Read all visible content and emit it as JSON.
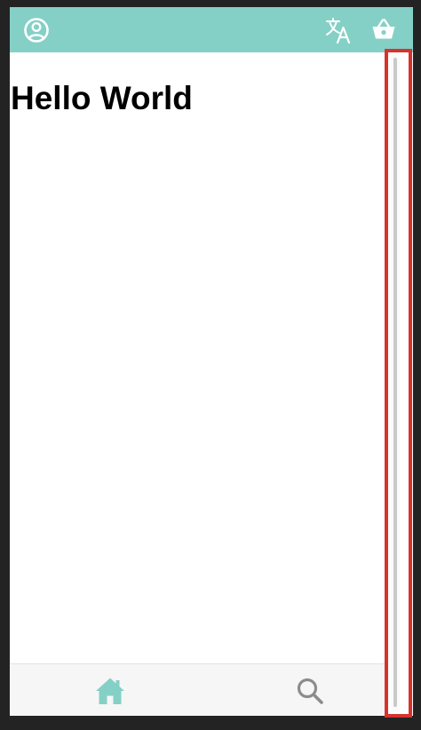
{
  "header": {
    "icons": {
      "account": "account-circle-icon",
      "translate": "translate-icon",
      "basket": "basket-icon"
    },
    "colors": {
      "background": "#84d0c6",
      "icon": "#ffffff"
    }
  },
  "main": {
    "heading": "Hello World"
  },
  "bottom_nav": {
    "items": [
      {
        "icon": "home-icon",
        "active": true,
        "color": "#84d0c6"
      },
      {
        "icon": "search-icon",
        "active": false,
        "color": "#8c8c8c"
      }
    ]
  },
  "colors": {
    "frame": "#232323",
    "highlight": "#d8322c",
    "scrollbar_thumb": "#c9c9c9"
  }
}
